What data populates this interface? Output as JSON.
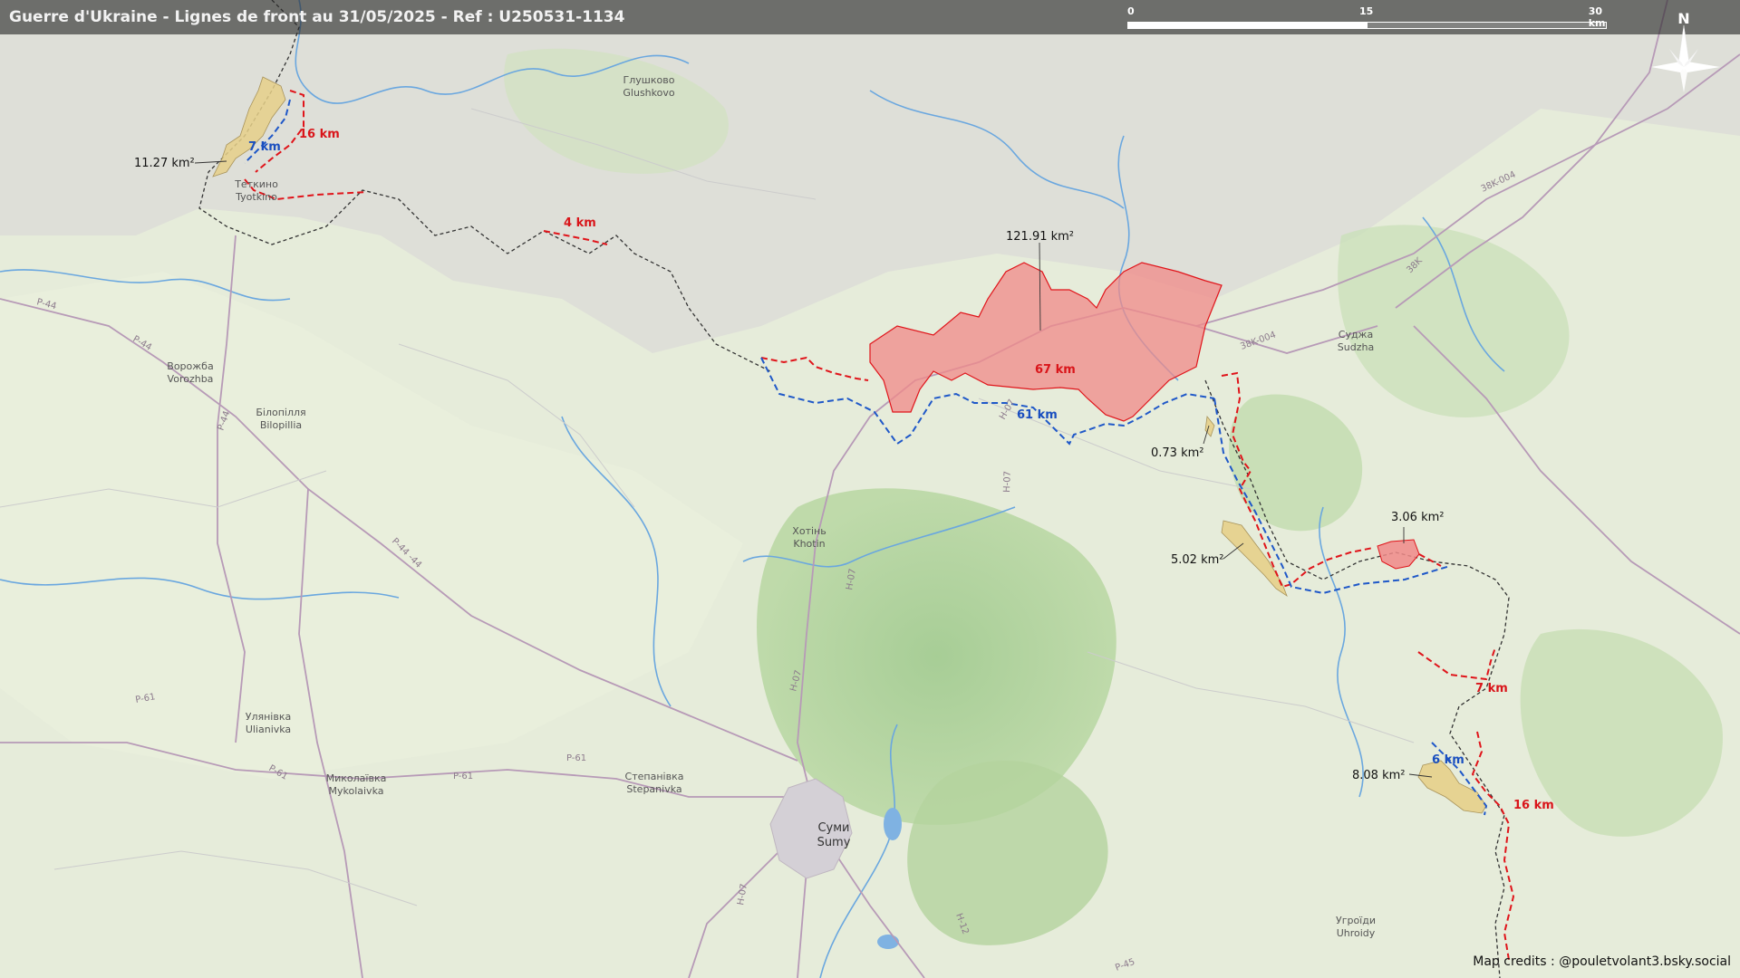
{
  "title": "Guerre d'Ukraine - Lignes de front au 31/05/2025 - Ref : U250531-1134",
  "scale": {
    "labels": [
      "0",
      "15",
      "30 km"
    ]
  },
  "north_label": "N",
  "credits": "Map credits : @pouletvolant3.bsky.social",
  "places": [
    {
      "name": "Глушково",
      "latin": "Glushkovo"
    },
    {
      "name": "Теткино",
      "latin": "Tyotkino"
    },
    {
      "name": "Ворожба",
      "latin": "Vorozhba"
    },
    {
      "name": "Білопілля",
      "latin": "Bilopillia"
    },
    {
      "name": "Хотінь",
      "latin": "Khotin"
    },
    {
      "name": "Суджа",
      "latin": "Sudzha"
    },
    {
      "name": "Улянівка",
      "latin": "Ulianivka"
    },
    {
      "name": "Миколаївка",
      "latin": "Mykolaivka"
    },
    {
      "name": "Степанівка",
      "latin": "Stepanivka"
    },
    {
      "name": "Суми",
      "latin": "Sumy"
    },
    {
      "name": "Угроїди",
      "latin": "Uhroidy"
    }
  ],
  "roads": [
    "P-44",
    "P-44",
    "P-44",
    "P-44 -44",
    "P-61",
    "P-61",
    "P-61",
    "P-61",
    "H-07",
    "H-07",
    "H-07",
    "H-07",
    "H-07",
    "H-12",
    "38K-004",
    "38K-004",
    "38K",
    "P-45"
  ],
  "areas": [
    {
      "label": "11.27 km²",
      "type": "ukr_gain"
    },
    {
      "label": "121.91 km²",
      "type": "rus_gain"
    },
    {
      "label": "0.73 km²",
      "type": "ukr_gain"
    },
    {
      "label": "5.02 km²",
      "type": "ukr_gain"
    },
    {
      "label": "3.06 km²",
      "type": "rus_gain"
    },
    {
      "label": "8.08 km²",
      "type": "ukr_gain"
    }
  ],
  "distances": {
    "red": [
      "16 km",
      "4 km",
      "67 km",
      "7 km",
      "16 km"
    ],
    "blue": [
      "7 km",
      "61 km",
      "6 km"
    ]
  },
  "colors": {
    "rus_fill": "#f08a88",
    "ukr_fill": "#e6d08a",
    "red_line": "#e0141a",
    "blue_line": "#1f58c8",
    "border": "#333333"
  }
}
